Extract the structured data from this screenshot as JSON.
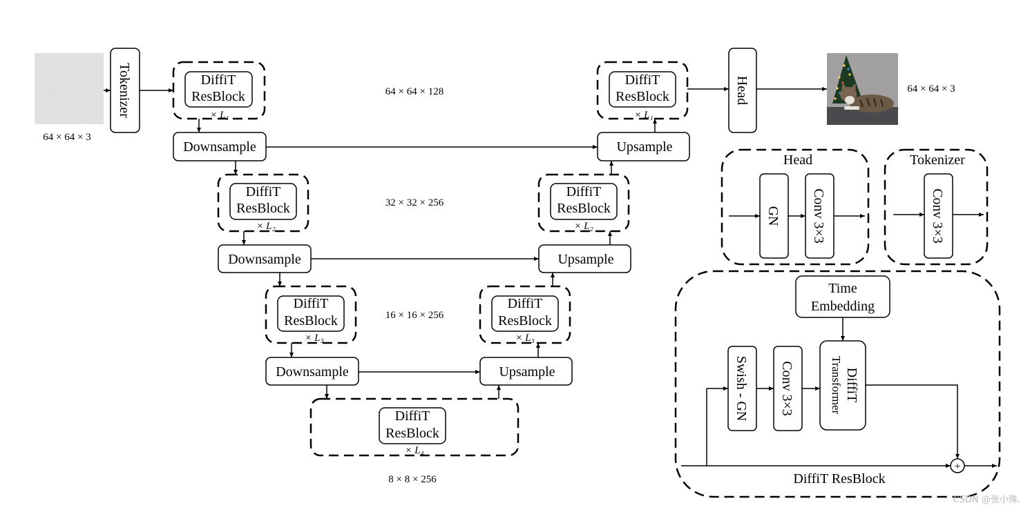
{
  "input": {
    "dims": "64 × 64 × 3"
  },
  "output": {
    "dims": "64 × 64 × 3"
  },
  "tokenizer": "Tokenizer",
  "head": "Head",
  "block": {
    "line1": "DiffiT",
    "line2": "ResBlock"
  },
  "repeat": [
    "× L₁",
    "× L₂",
    "× L₃",
    "× L₄"
  ],
  "downsample": "Downsample",
  "upsample": "Upsample",
  "levels": [
    "64 × 64 × 128",
    "32 × 32 × 256",
    "16 × 16 × 256",
    "8 × 8 × 256"
  ],
  "head_legend": {
    "title": "Head",
    "gn": "GN",
    "conv": "Conv 3×3"
  },
  "tokenizer_legend": {
    "title": "Tokenizer",
    "conv": "Conv 3×3"
  },
  "resblock_legend": {
    "title": "DiffiT ResBlock",
    "time_line1": "Time",
    "time_line2": "Embedding",
    "swish": "Swish - GN",
    "conv": "Conv 3×3",
    "transformer_line1": "DiffiT",
    "transformer_line2": "Transformer",
    "plus": "+"
  },
  "watermark": "CSDN @张小殊."
}
